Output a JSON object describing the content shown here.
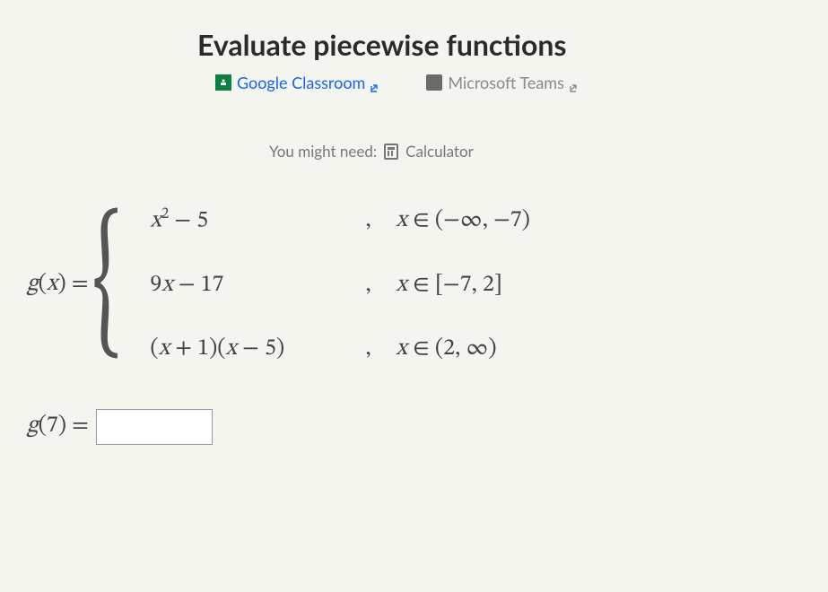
{
  "title": "Evaluate piecewise functions",
  "share": {
    "google": "Google Classroom",
    "teams": "Microsoft Teams"
  },
  "hint": {
    "prefix": "You might need:",
    "tool": "Calculator"
  },
  "piecewise": {
    "lhs": "g(x) =",
    "cases": [
      {
        "expr": "x² − 5",
        "cond": "x ∈ (−∞, −7)"
      },
      {
        "expr": "9x − 17",
        "cond": "x ∈ [−7, 2]"
      },
      {
        "expr": "(x + 1)(x − 5)",
        "cond": "x ∈ (2, ∞)"
      }
    ]
  },
  "question": {
    "prompt": "g(7) =",
    "value": ""
  }
}
